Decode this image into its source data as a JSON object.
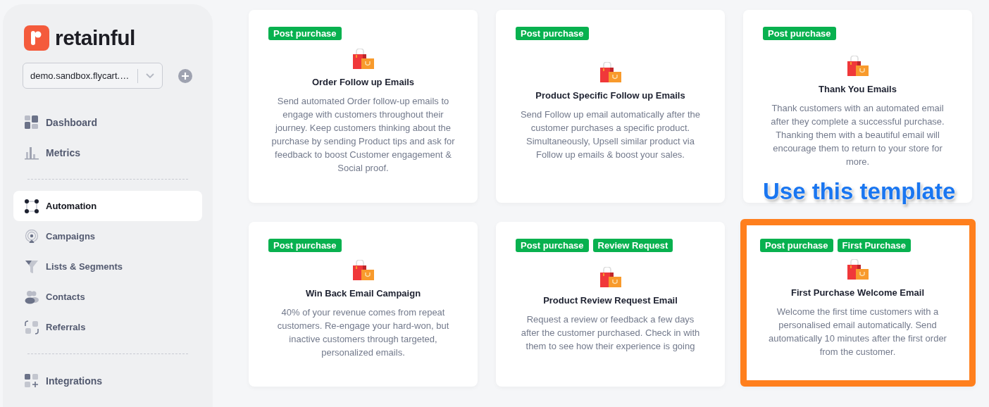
{
  "sidebar": {
    "logo": "retainful",
    "store_select": {
      "value": "demo.sandbox.flycart.…"
    },
    "nav_groups": [
      {
        "kind": "primary",
        "items": [
          {
            "label": "Dashboard",
            "selected": false
          },
          {
            "label": "Metrics",
            "selected": false
          }
        ]
      },
      {
        "kind": "secondary",
        "items": [
          {
            "label": "Automation",
            "selected": true
          },
          {
            "label": "Campaigns",
            "selected": false
          },
          {
            "label": "Lists & Segments",
            "selected": false
          },
          {
            "label": "Contacts",
            "selected": false
          },
          {
            "label": "Referrals",
            "selected": false
          }
        ]
      },
      {
        "kind": "primary",
        "items": [
          {
            "label": "Integrations",
            "selected": false
          }
        ]
      }
    ]
  },
  "templates": [
    {
      "tags": [
        "Post purchase"
      ],
      "title": "Order Follow up Emails",
      "description": "Send automated Order follow-up emails to engage with customers throughout their journey. Keep customers thinking about the purchase by sending Product tips and ask for feedback to boost Customer engagement & Social proof.",
      "highlighted": false
    },
    {
      "tags": [
        "Post purchase"
      ],
      "title": "Product Specific Follow up Emails",
      "description": "Send Follow up email automatically after the customer purchases a specific product. Simultaneously, Upsell similar product via Follow up emails & boost your sales.",
      "highlighted": false
    },
    {
      "tags": [
        "Post purchase"
      ],
      "title": "Thank You Emails",
      "description": "Thank customers with an automated email after they complete a successful purchase. Thanking them with a beautiful email will encourage them to return to your store for more.",
      "highlighted": false
    },
    {
      "tags": [
        "Post purchase"
      ],
      "title": "Win Back Email Campaign",
      "description": "40% of your revenue comes from repeat customers. Re-engage your hard-won, but inactive customers through targeted, personalized emails.",
      "highlighted": false
    },
    {
      "tags": [
        "Post purchase",
        "Review Request"
      ],
      "title": "Product Review Request Email",
      "description": "Request a review or feedback a few days after the customer purchased. Check in with them to see how their experience is going",
      "highlighted": false
    },
    {
      "tags": [
        "Post purchase",
        "First Purchase"
      ],
      "title": "First Purchase Welcome Email",
      "description": "Welcome the first time customers with a personalised email automatically. Send automatically 10 minutes after the first order from the customer.",
      "highlighted": true,
      "callout": "Use this template"
    }
  ]
}
